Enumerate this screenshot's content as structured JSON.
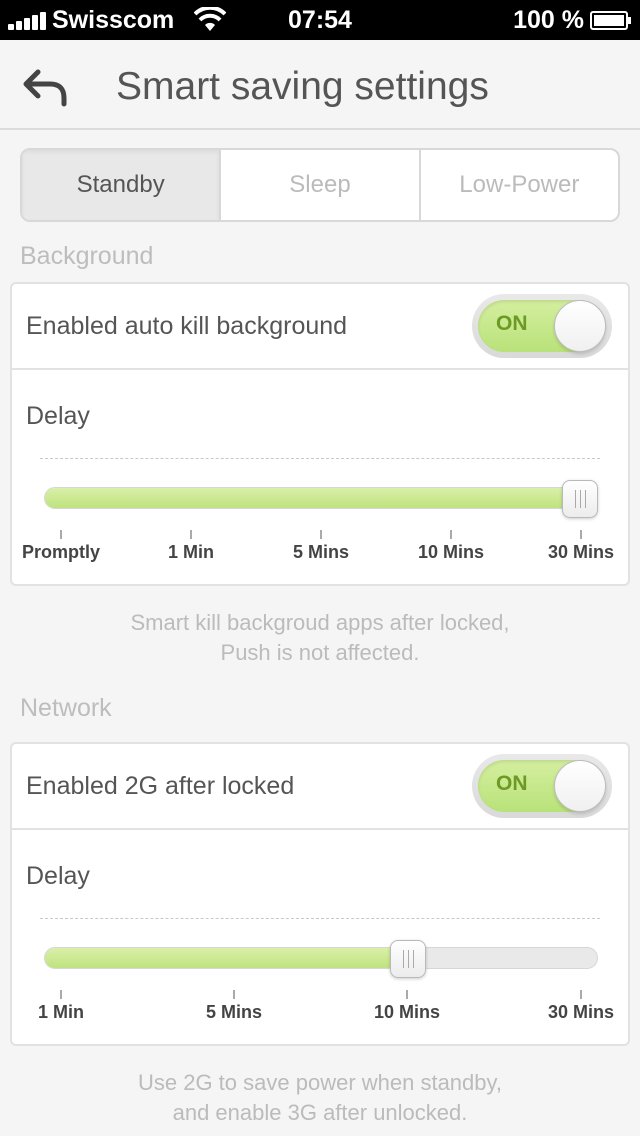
{
  "status_bar": {
    "carrier": "Swisscom",
    "time": "07:54",
    "battery": "100 %"
  },
  "nav": {
    "back_icon": "back-arrow-icon",
    "title": "Smart saving settings"
  },
  "tabs": [
    {
      "label": "Standby",
      "active": true
    },
    {
      "label": "Sleep",
      "active": false
    },
    {
      "label": "Low-Power",
      "active": false
    }
  ],
  "background": {
    "header": "Background",
    "toggle_label": "Enabled auto kill background",
    "toggle_state": "ON",
    "delay_label": "Delay",
    "slider": {
      "ticks": [
        "Promptly",
        "1 Min",
        "5 Mins",
        "10 Mins",
        "30 Mins"
      ],
      "selected": "30 Mins",
      "selected_index": 4
    },
    "footnote_line1": "Smart kill backgroud apps after locked,",
    "footnote_line2": "Push is not affected."
  },
  "network": {
    "header": "Network",
    "toggle_label": "Enabled 2G after locked",
    "toggle_state": "ON",
    "delay_label": "Delay",
    "slider": {
      "ticks": [
        "1 Min",
        "5 Mins",
        "10 Mins",
        "30 Mins"
      ],
      "selected": "10 Mins",
      "selected_index": 2
    },
    "footnote_line1": "Use 2G to save power when standby,",
    "footnote_line2": "and enable 3G after unlocked."
  },
  "colors": {
    "accent_green": "#bfe37f",
    "toggle_text": "#6c9a25"
  }
}
